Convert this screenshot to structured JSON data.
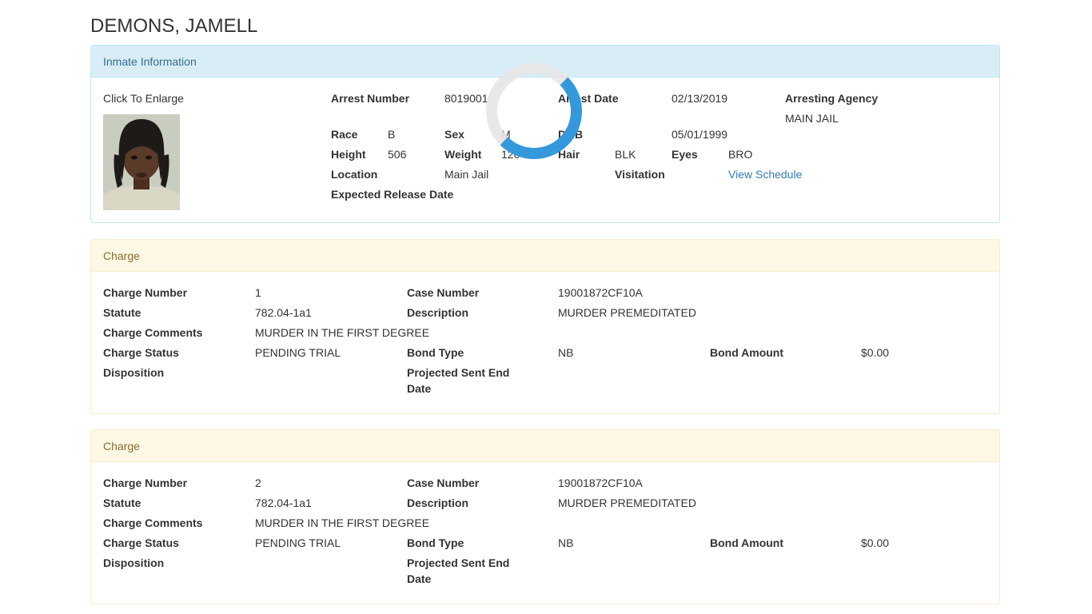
{
  "inmate": {
    "name": "DEMONS, JAMELL"
  },
  "info_panel": {
    "heading": "Inmate Information",
    "photo_caption": "Click To Enlarge",
    "labels": {
      "arrest_number": "Arrest Number",
      "arrest_date": "Arrest Date",
      "arresting_agency": "Arresting Agency",
      "race": "Race",
      "sex": "Sex",
      "dob": "DOB",
      "height": "Height",
      "weight": "Weight",
      "hair": "Hair",
      "eyes": "Eyes",
      "location": "Location",
      "visitation": "Visitation",
      "expected_release_date": "Expected Release Date"
    },
    "values": {
      "arrest_number": "8019001",
      "arrest_date": "02/13/2019",
      "arresting_agency": "MAIN JAIL",
      "race": "B",
      "sex": "M",
      "dob": "05/01/1999",
      "height": "506",
      "weight": "120",
      "hair": "BLK",
      "eyes": "BRO",
      "location": "Main Jail",
      "visitation_link": "View Schedule"
    }
  },
  "charge_labels": {
    "charge_number": "Charge Number",
    "case_number": "Case Number",
    "statute": "Statute",
    "description": "Description",
    "charge_comments": "Charge Comments",
    "charge_status": "Charge Status",
    "bond_type": "Bond Type",
    "bond_amount": "Bond Amount",
    "disposition": "Disposition",
    "projected_sent_end_date_1": "Projected Sent End",
    "projected_sent_end_date_2": "Date"
  },
  "charges": [
    {
      "heading": "Charge",
      "charge_number": "1",
      "case_number": "19001872CF10A",
      "statute": "782.04-1a1",
      "description": "MURDER PREMEDITATED",
      "charge_comments": "MURDER IN THE FIRST DEGREE",
      "charge_status": "PENDING TRIAL",
      "bond_type": "NB",
      "bond_amount": "$0.00"
    },
    {
      "heading": "Charge",
      "charge_number": "2",
      "case_number": "19001872CF10A",
      "statute": "782.04-1a1",
      "description": "MURDER PREMEDITATED",
      "charge_comments": "MURDER IN THE FIRST DEGREE",
      "charge_status": "PENDING TRIAL",
      "bond_type": "NB",
      "bond_amount": "$0.00"
    }
  ]
}
